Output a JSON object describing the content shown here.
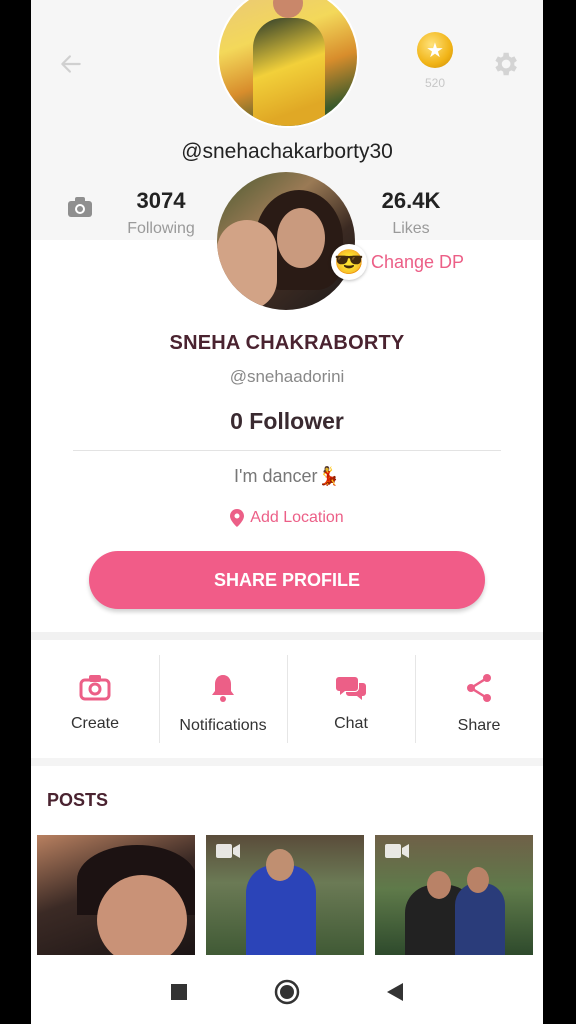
{
  "header": {
    "coin_count": "520",
    "username": "@snehachakarborty30"
  },
  "stats": {
    "following_value": "3074",
    "following_label": "Following",
    "likes_value": "26.4K",
    "likes_label": "Likes"
  },
  "profile": {
    "change_dp_emoji": "😎",
    "change_dp_label": "Change DP",
    "full_name": "SNEHA CHAKRABORTY",
    "handle": "@snehaadorini",
    "followers": "0 Follower",
    "bio": "I'm dancer💃",
    "location_label": "Add Location",
    "share_button": "SHARE PROFILE"
  },
  "actions": [
    {
      "label": "Create",
      "icon": "camera-icon"
    },
    {
      "label": "Notifications",
      "icon": "bell-icon"
    },
    {
      "label": "Chat",
      "icon": "chat-icon"
    },
    {
      "label": "Share",
      "icon": "share-icon"
    }
  ],
  "posts": {
    "title": "POSTS"
  },
  "colors": {
    "accent": "#f15c88",
    "title": "#4a2330"
  }
}
